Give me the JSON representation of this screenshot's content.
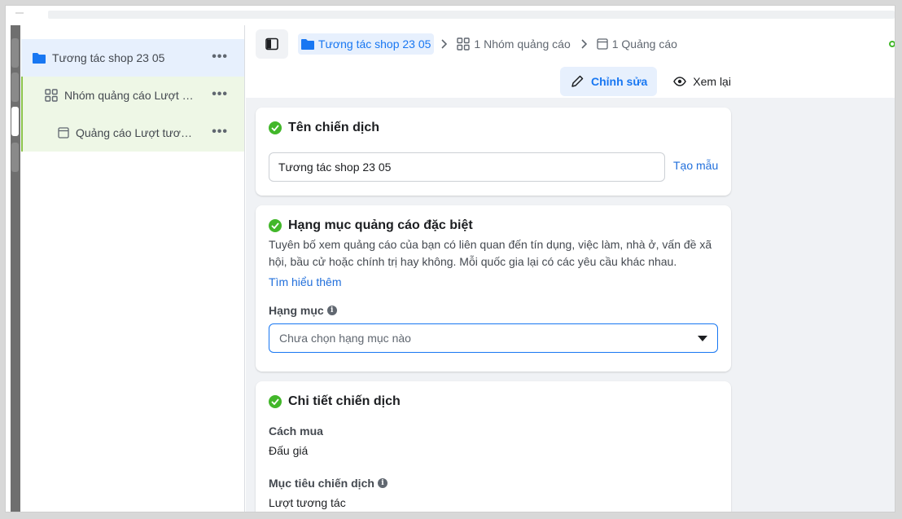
{
  "sidebar": {
    "items": [
      {
        "label": "Tương tác shop 23 05",
        "icon": "folder-icon",
        "more": "•••"
      },
      {
        "label": "Nhóm quảng cáo Lượt tương tác",
        "icon": "adset-grid-icon",
        "more": "•••"
      },
      {
        "label": "Quảng cáo Lượt tương tác",
        "icon": "ad-page-icon",
        "more": "•••"
      }
    ]
  },
  "breadcrumb": {
    "campaign": "Tương tác shop 23 05",
    "adsets": "1 Nhóm quảng cáo",
    "ads": "1 Quảng cáo"
  },
  "actions": {
    "edit_label": "Chỉnh sửa",
    "review_label": "Xem lại"
  },
  "campaign_name": {
    "title": "Tên chiến dịch",
    "value": "Tương tác shop 23 05",
    "template_link": "Tạo mẫu"
  },
  "special_category": {
    "title": "Hạng mục quảng cáo đặc biệt",
    "description": "Tuyên bố xem quảng cáo của bạn có liên quan đến tín dụng, việc làm, nhà ở, vấn đề xã hội, bầu cử hoặc chính trị hay không. Mỗi quốc gia lại có các yêu cầu khác nhau.",
    "learn_more": "Tìm hiểu thêm",
    "field_label": "Hạng mục",
    "select_placeholder": "Chưa chọn hạng mục nào"
  },
  "campaign_details": {
    "title": "Chi tiết chiến dịch",
    "buying_type_label": "Cách mua",
    "buying_type_value": "Đấu giá",
    "objective_label": "Mục tiêu chiến dịch",
    "objective_value": "Lượt tương tác"
  },
  "colors": {
    "accent": "#1877f2",
    "success": "#42b72a",
    "selected_bg": "#e7f0fd",
    "child_bg": "#eef7e6"
  }
}
